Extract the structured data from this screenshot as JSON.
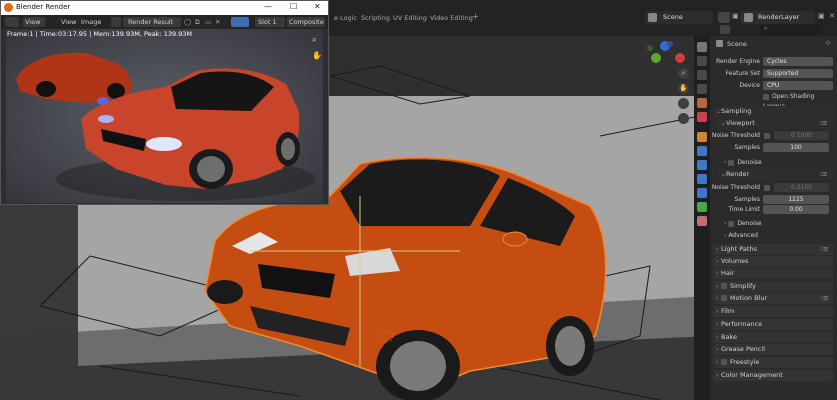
{
  "workspace_tabs": [
    "e Logic",
    "Scripting",
    "UV Editing",
    "Video Editing",
    "+"
  ],
  "scene": "Scene",
  "view_layer": "RenderLayer",
  "search_placeholder": "",
  "render_window": {
    "title": "Blender Render",
    "menus": [
      "View",
      "View",
      "Image"
    ],
    "image_name": "Render Result",
    "slot": "Slot 1",
    "pass": "Composite",
    "status": "Frame:1 | Time:03:17.95 | Mem:139.93M, Peak: 139.93M"
  },
  "properties": {
    "breadcrumb": "Scene",
    "render_engine_label": "Render Engine",
    "render_engine": "Cycles",
    "feature_set_label": "Feature Set",
    "feature_set": "Supported",
    "device_label": "Device",
    "device": "CPU",
    "osl_label": "Open Shading Langua...",
    "sampling": "Sampling",
    "viewport": "Viewport",
    "noise_threshold_label": "Noise Threshold",
    "vp_noise": "0.1000",
    "samples_label": "Samples",
    "vp_samples": "100",
    "denoise": "Denoise",
    "render": "Render",
    "r_noise": "0.0100",
    "r_samples": "1225",
    "time_limit_label": "Time Limit",
    "time_limit": "0.00",
    "denoise2": "Denoise",
    "advanced": "Advanced",
    "panels": [
      "Light Paths",
      "Volumes",
      "Hair",
      "Simplify",
      "Motion Blur",
      "Film",
      "Performance",
      "Bake",
      "Grease Pencil",
      "Freestyle",
      "Color Management"
    ]
  },
  "colors": {
    "accent": "#d2561a",
    "header": "#232323",
    "panel": "#2b2b2b"
  }
}
